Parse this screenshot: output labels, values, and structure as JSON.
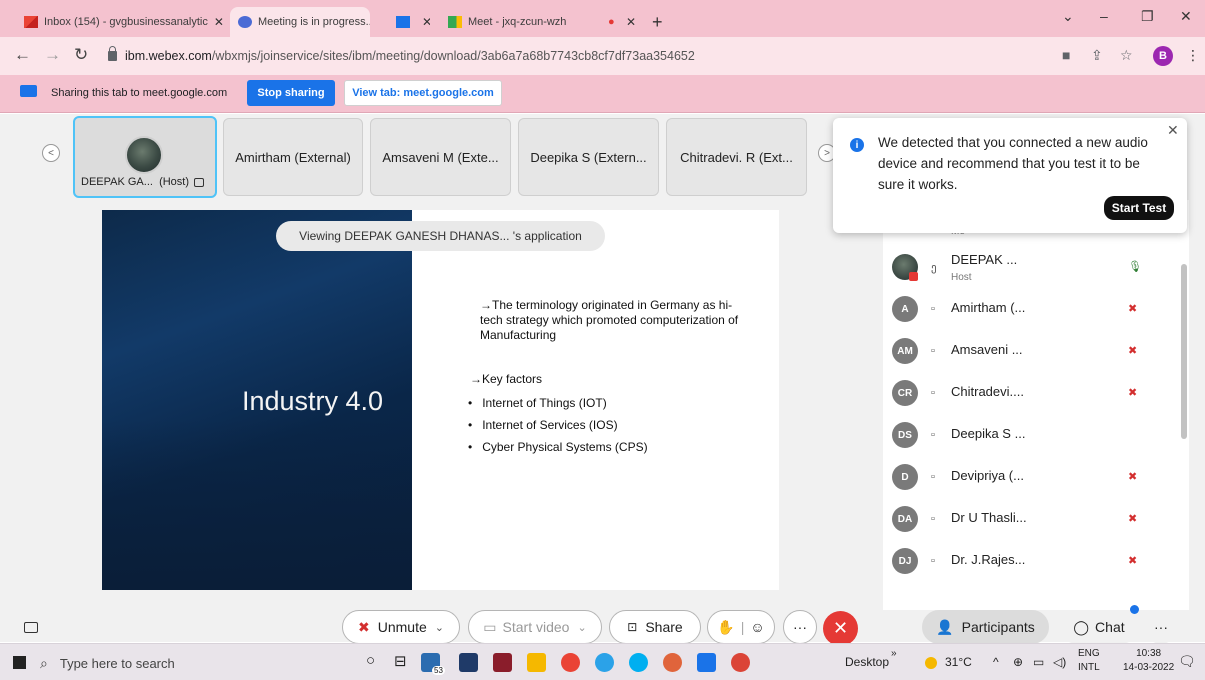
{
  "browser": {
    "tabs": [
      {
        "label": "Inbox (154) - gvgbusinessanalytic"
      },
      {
        "label": "Meeting is in progress..."
      },
      {
        "label": ""
      },
      {
        "label": "Meet - jxq-zcun-wzh"
      },
      {
        "label": ""
      }
    ],
    "new_tab_glyph": "+",
    "url_host": "ibm.webex.com",
    "url_path": "/wbxmjs/joinservice/sites/ibm/meeting/download/3ab6a7a68b7743cb8cf7df73aa354652",
    "profile_initial": "B"
  },
  "sharebar": {
    "text": "Sharing this tab to meet.google.com",
    "stop_label": "Stop sharing",
    "view_label": "View tab: meet.google.com"
  },
  "strip": {
    "host_name": "DEEPAK GA...",
    "host_tag": "(Host)",
    "participants": [
      "Amirtham (External)",
      "Amsaveni M (Exte...",
      "Deepika S (Extern...",
      "Chitradevi. R (Ext..."
    ]
  },
  "presentation": {
    "viewing": "Viewing DEEPAK GANESH DHANAS... 's application",
    "title": "Industry 4.0",
    "paragraph": "→The terminology originated in Germany as hi-tech strategy which promoted computerization of Manufacturing",
    "key_heading": "→Key factors",
    "bullets": [
      "Internet of Things (IOT)",
      "Internet of Services (IOS)",
      "Cyber Physical Systems (CPS)"
    ]
  },
  "notification": {
    "text": "We detected that you connected a new audio device and recommend that you test it to be sure it works.",
    "button": "Start Test"
  },
  "participants_panel": {
    "me_label": "Me",
    "rows": [
      {
        "initials": "",
        "name": "DEEPAK ...",
        "sub": "Host",
        "muted": false
      },
      {
        "initials": "A",
        "name": "Amirtham (...",
        "sub": "",
        "muted": true
      },
      {
        "initials": "AM",
        "name": "Amsaveni ...",
        "sub": "",
        "muted": true
      },
      {
        "initials": "CR",
        "name": "Chitradevi....",
        "sub": "",
        "muted": true
      },
      {
        "initials": "DS",
        "name": "Deepika S ...",
        "sub": "",
        "muted": false
      },
      {
        "initials": "D",
        "name": "Devipriya (...",
        "sub": "",
        "muted": true
      },
      {
        "initials": "DA",
        "name": "Dr U Thasli...",
        "sub": "",
        "muted": true
      },
      {
        "initials": "DJ",
        "name": "Dr. J.Rajes...",
        "sub": "",
        "muted": true
      }
    ]
  },
  "controls": {
    "unmute": "Unmute",
    "start_video": "Start video",
    "share": "Share",
    "more": "···",
    "participants": "Participants",
    "chat": "Chat"
  },
  "taskbar": {
    "search_placeholder": "Type here to search",
    "badge_count": "53",
    "desktop": "Desktop",
    "temperature": "31°C",
    "lang_line1": "ENG",
    "lang_line2": "INTL",
    "time": "10:38",
    "date": "14-03-2022"
  }
}
